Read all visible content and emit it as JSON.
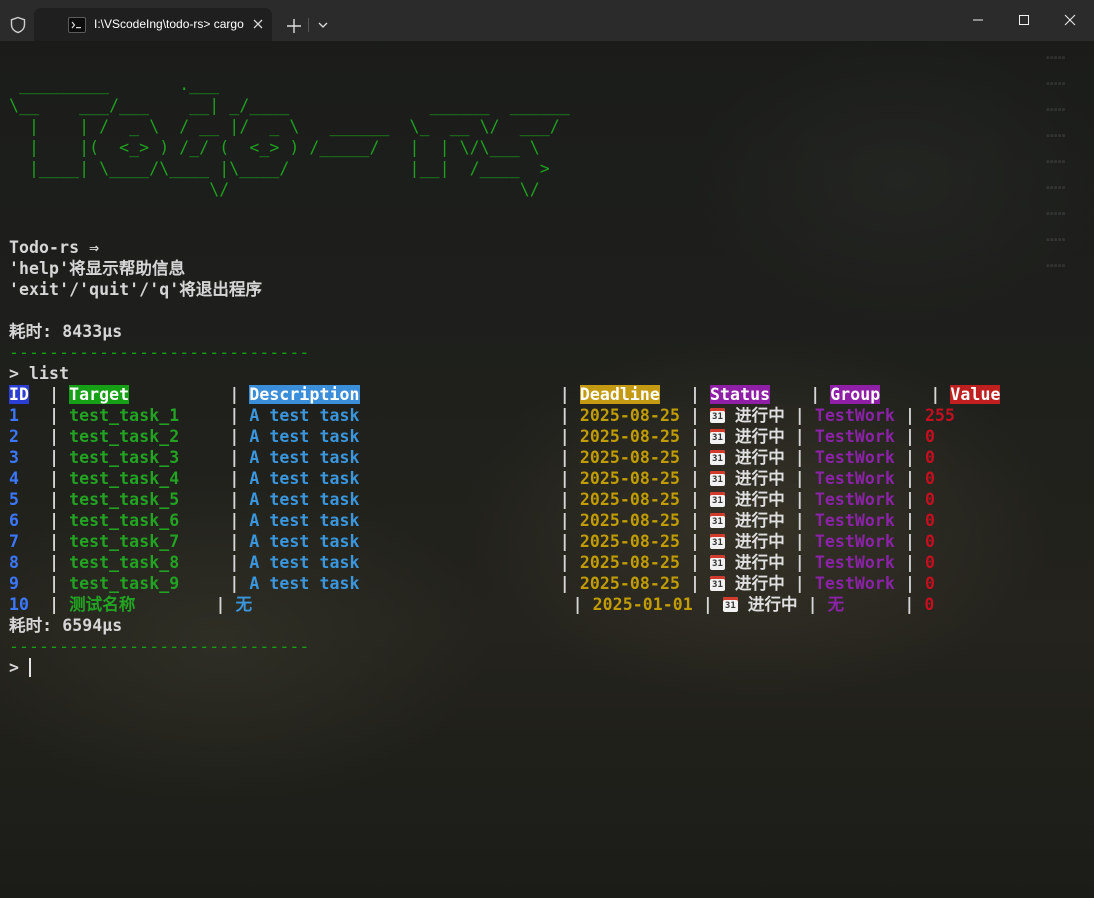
{
  "window": {
    "tab_title": "I:\\VScodeIng\\todo-rs> cargo"
  },
  "terminal": {
    "banner": [
      " _________       .___",
      "\\__    ___/___    __| _/____              ______  ______",
      "  |    | /  _ \\  / __ |/  _ \\   ______  \\_  __ \\/  ___/",
      "  |    |(  <_> ) /_/ (  <_> ) /_____/   |  | \\/\\___ \\",
      "  |____| \\____/\\____ |\\____/            |__|  /____  >",
      "                    \\/                             \\/"
    ],
    "prompt_title": "Todo-rs ⇒",
    "help_hint": "'help'将显示帮助信息",
    "exit_hint": "'exit'/'quit'/'q'将退出程序",
    "elapsed_1": "耗时: 8433µs",
    "rule": "------------------------------",
    "command": "> list",
    "headers": {
      "id": "ID",
      "target": "Target",
      "description": "Description",
      "deadline": "Deadline",
      "status": "Status",
      "group": "Group",
      "value": "Value"
    },
    "rows": [
      {
        "id": "1",
        "target": "test_task_1",
        "description": "A test task",
        "deadline": "2025-08-25",
        "status": "进行中",
        "group": "TestWork",
        "value": "255"
      },
      {
        "id": "2",
        "target": "test_task_2",
        "description": "A test task",
        "deadline": "2025-08-25",
        "status": "进行中",
        "group": "TestWork",
        "value": "0"
      },
      {
        "id": "3",
        "target": "test_task_3",
        "description": "A test task",
        "deadline": "2025-08-25",
        "status": "进行中",
        "group": "TestWork",
        "value": "0"
      },
      {
        "id": "4",
        "target": "test_task_4",
        "description": "A test task",
        "deadline": "2025-08-25",
        "status": "进行中",
        "group": "TestWork",
        "value": "0"
      },
      {
        "id": "5",
        "target": "test_task_5",
        "description": "A test task",
        "deadline": "2025-08-25",
        "status": "进行中",
        "group": "TestWork",
        "value": "0"
      },
      {
        "id": "6",
        "target": "test_task_6",
        "description": "A test task",
        "deadline": "2025-08-25",
        "status": "进行中",
        "group": "TestWork",
        "value": "0"
      },
      {
        "id": "7",
        "target": "test_task_7",
        "description": "A test task",
        "deadline": "2025-08-25",
        "status": "进行中",
        "group": "TestWork",
        "value": "0"
      },
      {
        "id": "8",
        "target": "test_task_8",
        "description": "A test task",
        "deadline": "2025-08-25",
        "status": "进行中",
        "group": "TestWork",
        "value": "0"
      },
      {
        "id": "9",
        "target": "test_task_9",
        "description": "A test task",
        "deadline": "2025-08-25",
        "status": "进行中",
        "group": "TestWork",
        "value": "0"
      },
      {
        "id": "10",
        "target": "测试名称",
        "description": "无",
        "deadline": "2025-01-01",
        "status": "进行中",
        "group": "无",
        "value": "0"
      }
    ],
    "calendar_glyph": "31",
    "elapsed_2": "耗时: 6594µs",
    "final_prompt": "> "
  },
  "icons": {
    "shield": "shield-icon",
    "terminal_tab": "terminal-icon",
    "close_tab": "close-icon",
    "new_tab": "plus-icon",
    "dropdown": "chevron-down-icon",
    "status": "calendar-icon"
  },
  "colors": {
    "banner": "#1ea11e",
    "id": "#3b78ff",
    "target": "#22a322",
    "description": "#3a96dd",
    "deadline": "#c19c00",
    "group": "#8b22a8",
    "value": "#c50f1f"
  }
}
